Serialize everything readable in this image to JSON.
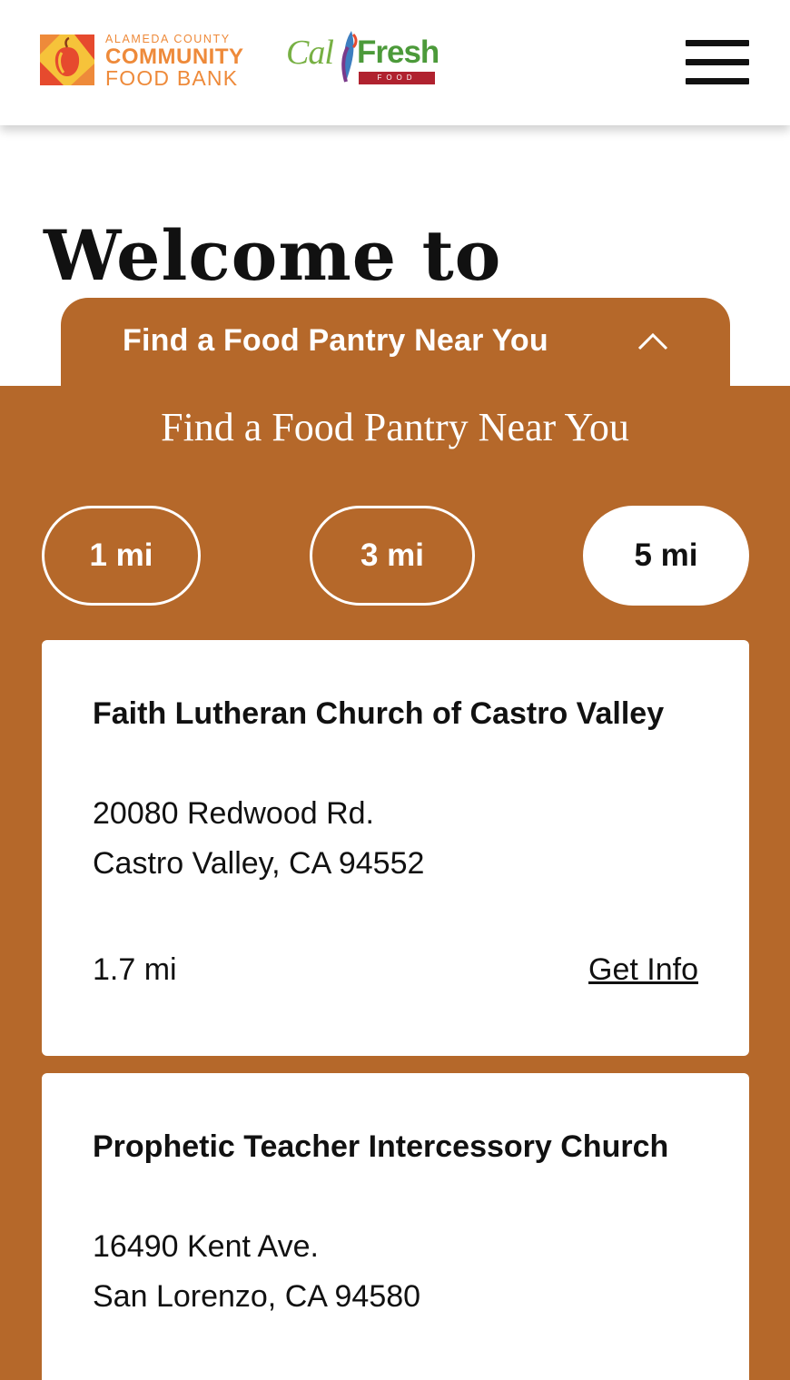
{
  "header": {
    "logo": {
      "line1": "ALAMEDA COUNTY",
      "line2": "COMMUNITY",
      "line3": "FOOD BANK"
    },
    "partner_logo": {
      "cal": "Cal",
      "fresh": "Fresh",
      "food": "FOOD"
    },
    "menu_icon": "hamburger-menu-icon"
  },
  "hero": {
    "heading": "Welcome to"
  },
  "drawer": {
    "tab_label": "Find a Food Pantry Near You",
    "tab_icon": "chevron-up-icon",
    "title": "Find a Food Pantry Near You",
    "distance_options": [
      "1 mi",
      "3 mi",
      "5 mi"
    ],
    "selected_distance": "5 mi"
  },
  "pantries": [
    {
      "name": "Faith Lutheran Church of Castro Valley",
      "address_line1": "20080 Redwood Rd.",
      "address_line2": "Castro Valley, CA 94552",
      "distance": "1.7 mi",
      "link_label": "Get Info"
    },
    {
      "name": "Prophetic Teacher Intercessory Church",
      "address_line1": "16490 Kent Ave.",
      "address_line2": "San Lorenzo, CA 94580"
    }
  ],
  "colors": {
    "accent": "#b5682a",
    "logo_orange": "#ee8a3a",
    "calfresh_green": "#4c9a3a",
    "calfresh_red": "#b0222f"
  }
}
